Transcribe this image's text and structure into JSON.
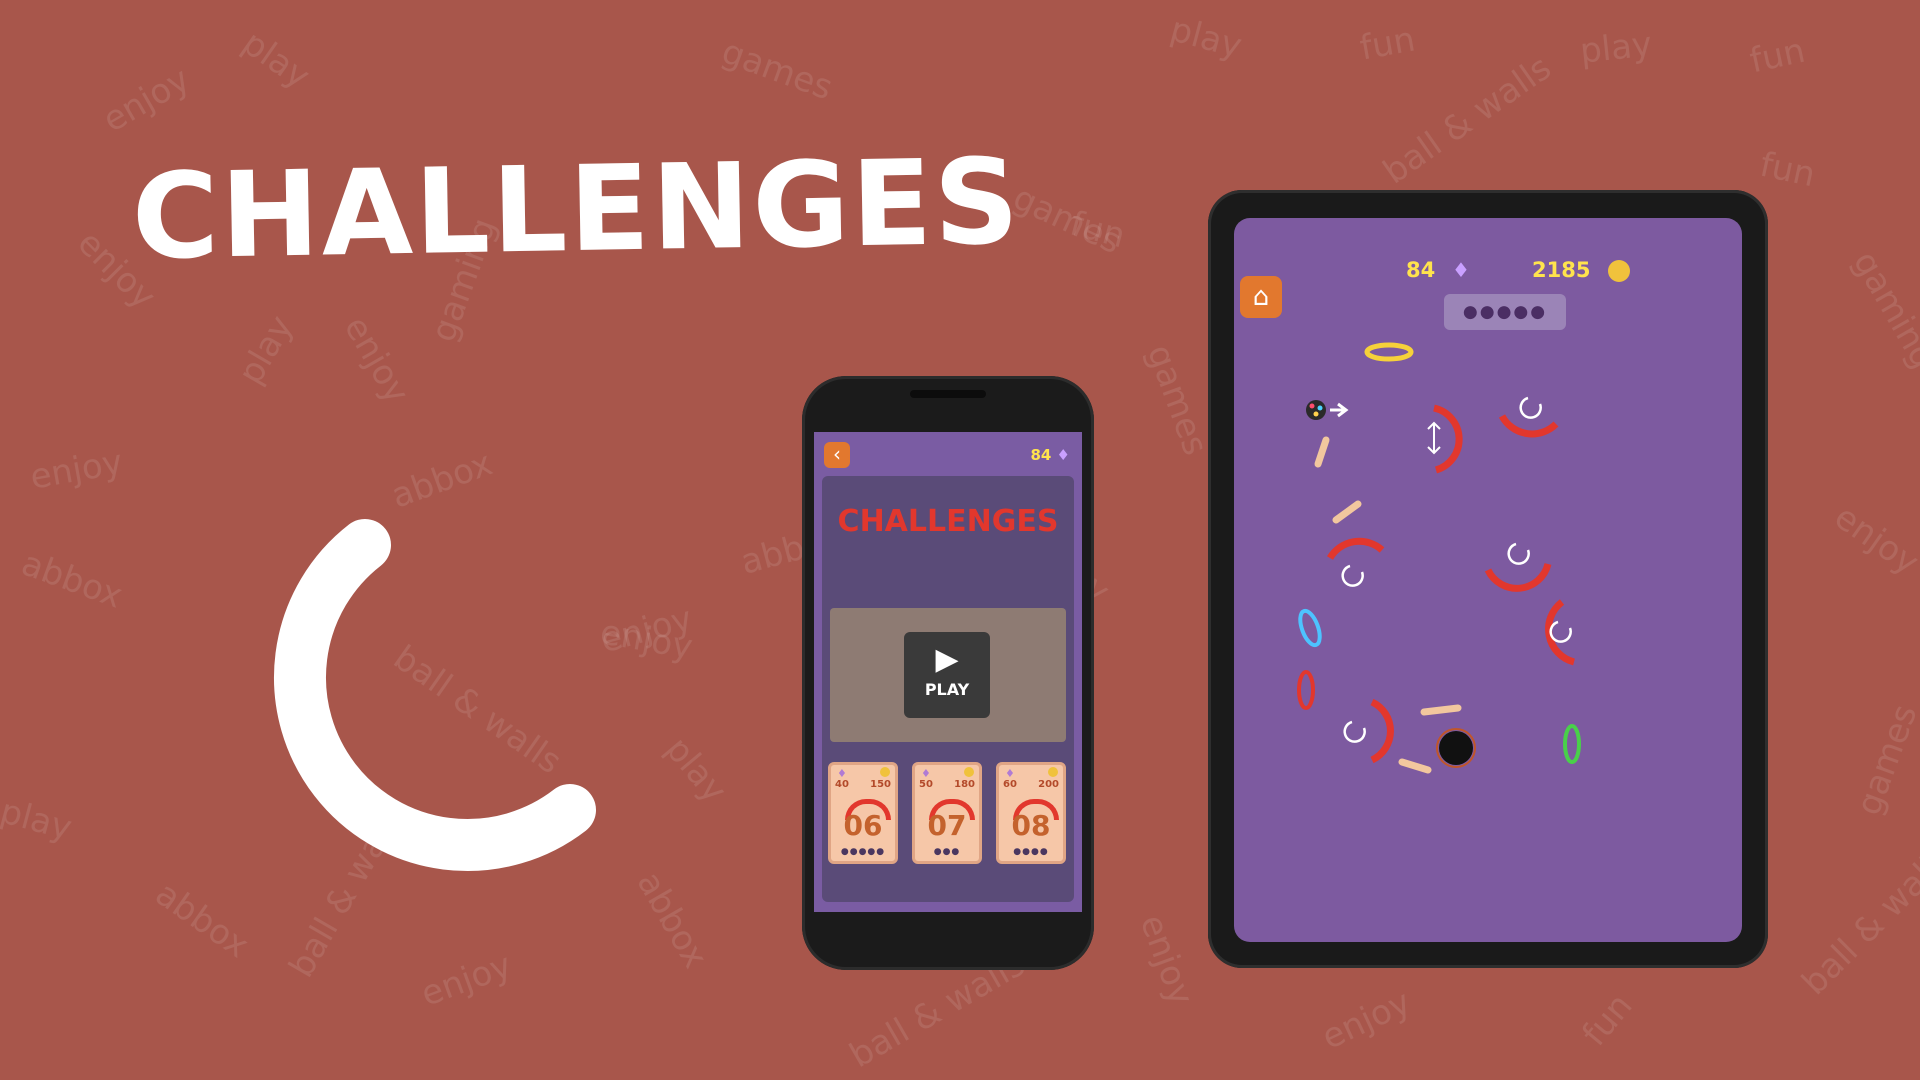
{
  "headline": "CHALLENGES",
  "background_words": [
    "games",
    "play",
    "fun",
    "enjoy",
    "joy",
    "abbox",
    "ball & walls",
    "gaming"
  ],
  "phone": {
    "gem_count": "84",
    "back_icon": "chevron-left-icon",
    "title": "CHALLENGES",
    "play_label": "PLAY",
    "cards": [
      {
        "gems": "40",
        "coins": "150",
        "level": "06"
      },
      {
        "gems": "50",
        "coins": "180",
        "level": "07"
      },
      {
        "gems": "60",
        "coins": "200",
        "level": "08"
      }
    ]
  },
  "tablet": {
    "gems": "84",
    "coins": "2185",
    "home_icon": "home-icon",
    "balls_remaining": 5
  },
  "colors": {
    "background": "#a8564b",
    "game_bg": "#7d5aa0",
    "accent_orange": "#e2782e",
    "accent_red": "#e2372d",
    "gold": "#ffe34d"
  }
}
